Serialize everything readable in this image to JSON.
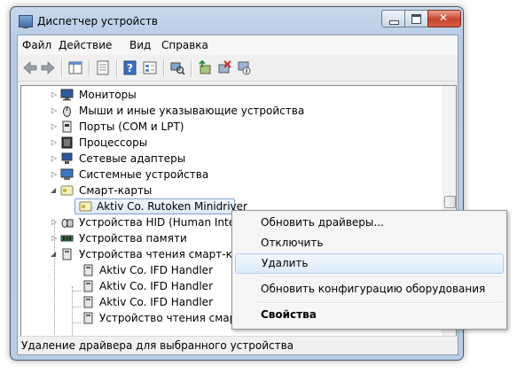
{
  "window": {
    "title": "Диспетчер устройств"
  },
  "menu": {
    "items": [
      "Файл",
      "Действие",
      "Вид",
      "Справка"
    ]
  },
  "tree": {
    "items": [
      {
        "label": "Мониторы",
        "icon": "monitor-icon"
      },
      {
        "label": "Мыши и иные указывающие устройства",
        "icon": "mouse-icon"
      },
      {
        "label": "Порты (COM и LPT)",
        "icon": "port-icon"
      },
      {
        "label": "Процессоры",
        "icon": "processor-icon"
      },
      {
        "label": "Сетевые адаптеры",
        "icon": "network-adapter-icon"
      },
      {
        "label": "Системные устройства",
        "icon": "system-device-icon"
      },
      {
        "label": "Смарт-карты",
        "icon": "smart-card-icon"
      },
      {
        "label": "Aktiv Co. Rutoken Minidriver",
        "icon": "smart-card-icon"
      },
      {
        "label": "Устройства HID (Human Interface Devices)",
        "icon": "hid-icon"
      },
      {
        "label": "Устройства памяти",
        "icon": "memory-icon"
      },
      {
        "label": "Устройства чтения смарт-карт",
        "icon": "card-reader-icon"
      },
      {
        "label": "Aktiv Co. IFD Handler",
        "icon": "card-reader-icon"
      },
      {
        "label": "Aktiv Co. IFD Handler",
        "icon": "card-reader-icon"
      },
      {
        "label": "Aktiv Co. IFD Handler",
        "icon": "card-reader-icon"
      },
      {
        "label": "Устройство чтения смарт-карт",
        "icon": "card-reader-icon"
      }
    ]
  },
  "context_menu": {
    "items": [
      "Обновить драйверы...",
      "Отключить",
      "Удалить",
      "Обновить конфигурацию оборудования",
      "Свойства"
    ]
  },
  "status": {
    "text": "Удаление драйвера для выбранного устройства"
  },
  "colors": {
    "selection_border": "#7da2ce",
    "close_button": "#c7452d",
    "menu_hover": "#dcebfc"
  }
}
